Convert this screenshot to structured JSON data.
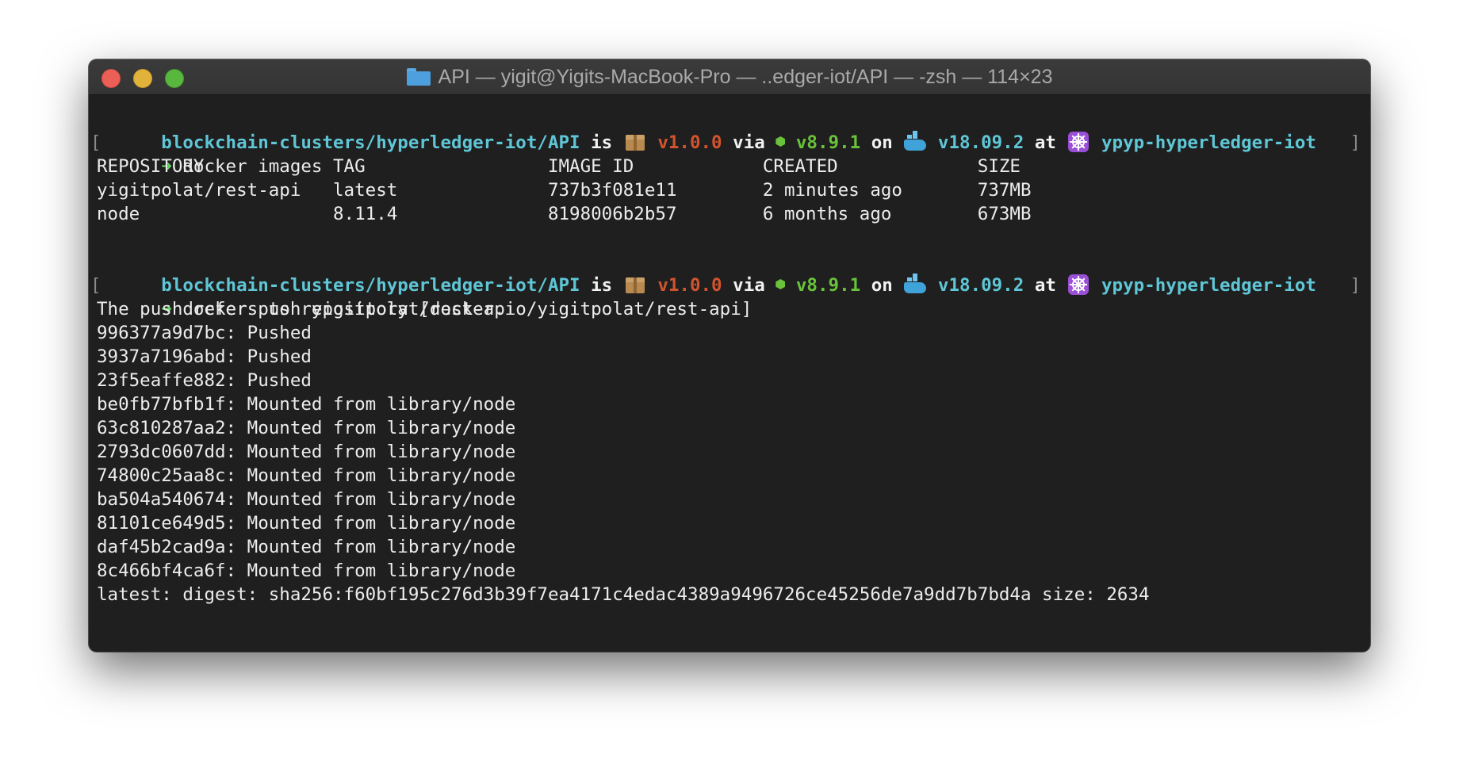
{
  "window": {
    "title": "API — yigit@Yigits-MacBook-Pro — ..edger-iot/API — -zsh — 114×23"
  },
  "prompt": {
    "path": "blockchain-clusters/hyperledger-iot/API",
    "is": "is",
    "version": "v1.0.0",
    "via": "via",
    "node_version": "v8.9.1",
    "on": "on",
    "docker_version": "v18.09.2",
    "at": "at",
    "k8s_context": "ypyp-hyperledger-iot",
    "arrow": "➜",
    "bracket_left": "[",
    "bracket_right": "]"
  },
  "commands": {
    "first": "docker images",
    "second": "docker push yigitpolat/rest-api"
  },
  "images_table": {
    "header": "REPOSITORY            TAG                 IMAGE ID            CREATED             SIZE",
    "rows": [
      "yigitpolat/rest-api   latest              737b3f081e11        2 minutes ago       737MB",
      "node                  8.11.4              8198006b2b57        6 months ago        673MB"
    ]
  },
  "push_output": [
    "The push refers to repository [docker.io/yigitpolat/rest-api]",
    "996377a9d7bc: Pushed",
    "3937a7196abd: Pushed",
    "23f5eaffe882: Pushed",
    "be0fb77bfb1f: Mounted from library/node",
    "63c810287aa2: Mounted from library/node",
    "2793dc0607dd: Mounted from library/node",
    "74800c25aa8c: Mounted from library/node",
    "ba504a540674: Mounted from library/node",
    "81101ce649d5: Mounted from library/node",
    "daf45b2cad9a: Mounted from library/node",
    "8c466bf4ca6f: Mounted from library/node",
    "latest: digest: sha256:f60bf195c276d3b39f7ea4171c4edac4389a9496726ce45256de7a9dd7b7bd4a size: 2634"
  ],
  "colors": {
    "background": "#1f1f1f",
    "path": "#5fc6d6",
    "version": "#d2542f",
    "node": "#6ac23a",
    "text": "#ececec"
  },
  "icons": {
    "package": "package-icon",
    "node": "node-hexagon-icon",
    "docker": "docker-whale-icon",
    "kubernetes": "helm-wheel-icon",
    "folder": "folder-icon"
  }
}
